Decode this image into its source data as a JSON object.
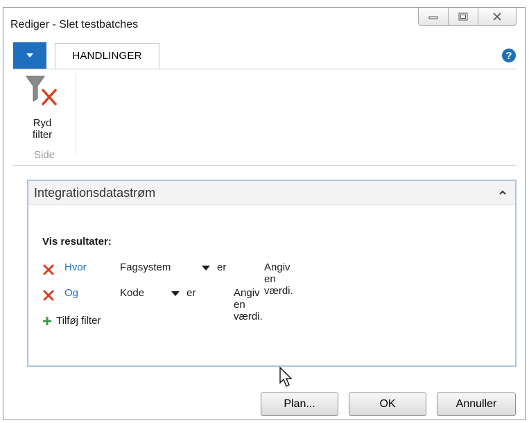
{
  "window": {
    "title": "Rediger - Slet testbatches",
    "controls": [
      "minimize-icon",
      "restore-icon",
      "close-icon"
    ]
  },
  "ribbon": {
    "tabs": [
      {
        "label": "HANDLINGER",
        "active": true
      }
    ],
    "groups": [
      {
        "label": "Side",
        "buttons": [
          {
            "label": "Ryd\nfilter",
            "icon": "clear-filter-icon"
          }
        ]
      }
    ],
    "help_icon": "help-icon"
  },
  "fasttab": {
    "title": "Integrationsdatastrøm",
    "vis_label": "Vis resultater:",
    "filters": [
      {
        "connector": "Hvor",
        "field": "Fagsystem",
        "operator": "er",
        "value": "Angiv en værdi."
      },
      {
        "connector": "Og",
        "field": "Kode",
        "operator": "er",
        "value": "Angiv en værdi."
      }
    ],
    "add_filter_label": "Tilføj filter"
  },
  "footer": {
    "plan_label": "Plan...",
    "ok_label": "OK",
    "cancel_label": "Annuller"
  },
  "colors": {
    "accent": "#1f6fbf",
    "remove": "#d9401e",
    "add": "#3a9a4a",
    "fasttab_border": "#a9c4e6"
  }
}
